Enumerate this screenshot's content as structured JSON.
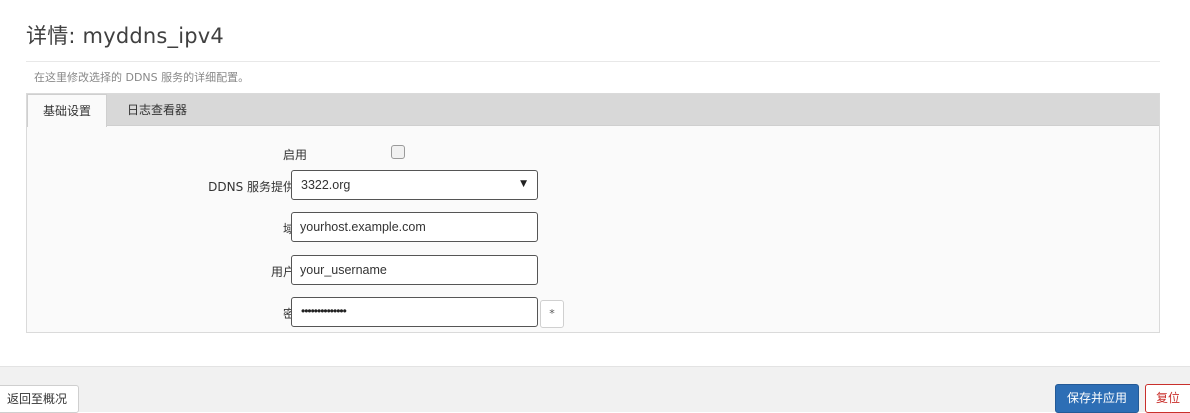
{
  "page": {
    "title": "详情: myddns_ipv4",
    "description": "在这里修改选择的 DDNS 服务的详细配置。"
  },
  "tabs": [
    {
      "label": "基础设置",
      "active": true
    },
    {
      "label": "日志查看器",
      "active": false
    }
  ],
  "form": {
    "enable": {
      "label": "启用",
      "checked": false
    },
    "provider": {
      "label": "DDNS 服务提供商",
      "value": "3322.org"
    },
    "domain": {
      "label": "域名",
      "value": "yourhost.example.com"
    },
    "username": {
      "label": "用户名",
      "value": "your_username"
    },
    "password": {
      "label": "密码",
      "masked": "••••••••••••••",
      "reveal_label": "*"
    }
  },
  "footer": {
    "back_label": "返回至概况",
    "save_apply_label": "保存并应用",
    "reset_label": "复位"
  },
  "colors": {
    "primary": "#2d6eb5",
    "danger": "#c9302c",
    "tabbar": "#d8d8d8"
  }
}
